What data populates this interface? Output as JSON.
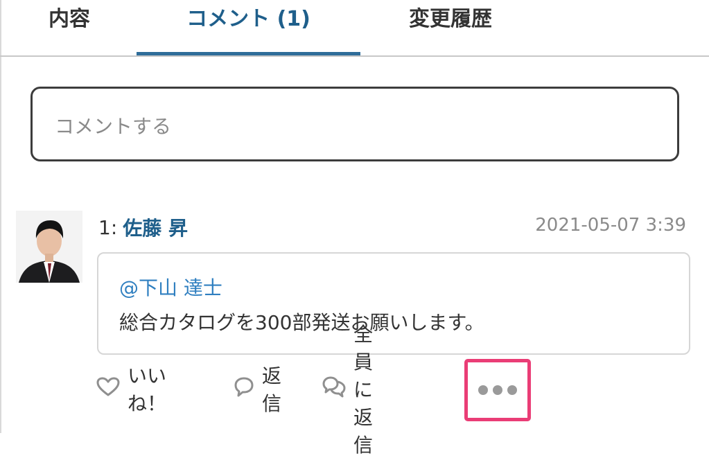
{
  "tabs": [
    {
      "label": "内容"
    },
    {
      "label": "コメント (1)",
      "active": true
    },
    {
      "label": "変更履歴"
    }
  ],
  "comment_input": {
    "placeholder": "コメントする"
  },
  "comment": {
    "number": "1:",
    "author": "佐藤 昇",
    "timestamp": "2021-05-07 3:39",
    "mention": "@下山 達士",
    "text": "総合カタログを300部発送お願いします。"
  },
  "actions": {
    "like_label": "いいね！",
    "reply_label": "返信",
    "reply_all_label": "全員に返信",
    "more_icon": "more-dots-icon"
  },
  "colors": {
    "accent": "#1f5f8b",
    "tab_underline": "#2f6d99",
    "mention": "#2f7fc0",
    "highlight": "#ea3d76"
  }
}
